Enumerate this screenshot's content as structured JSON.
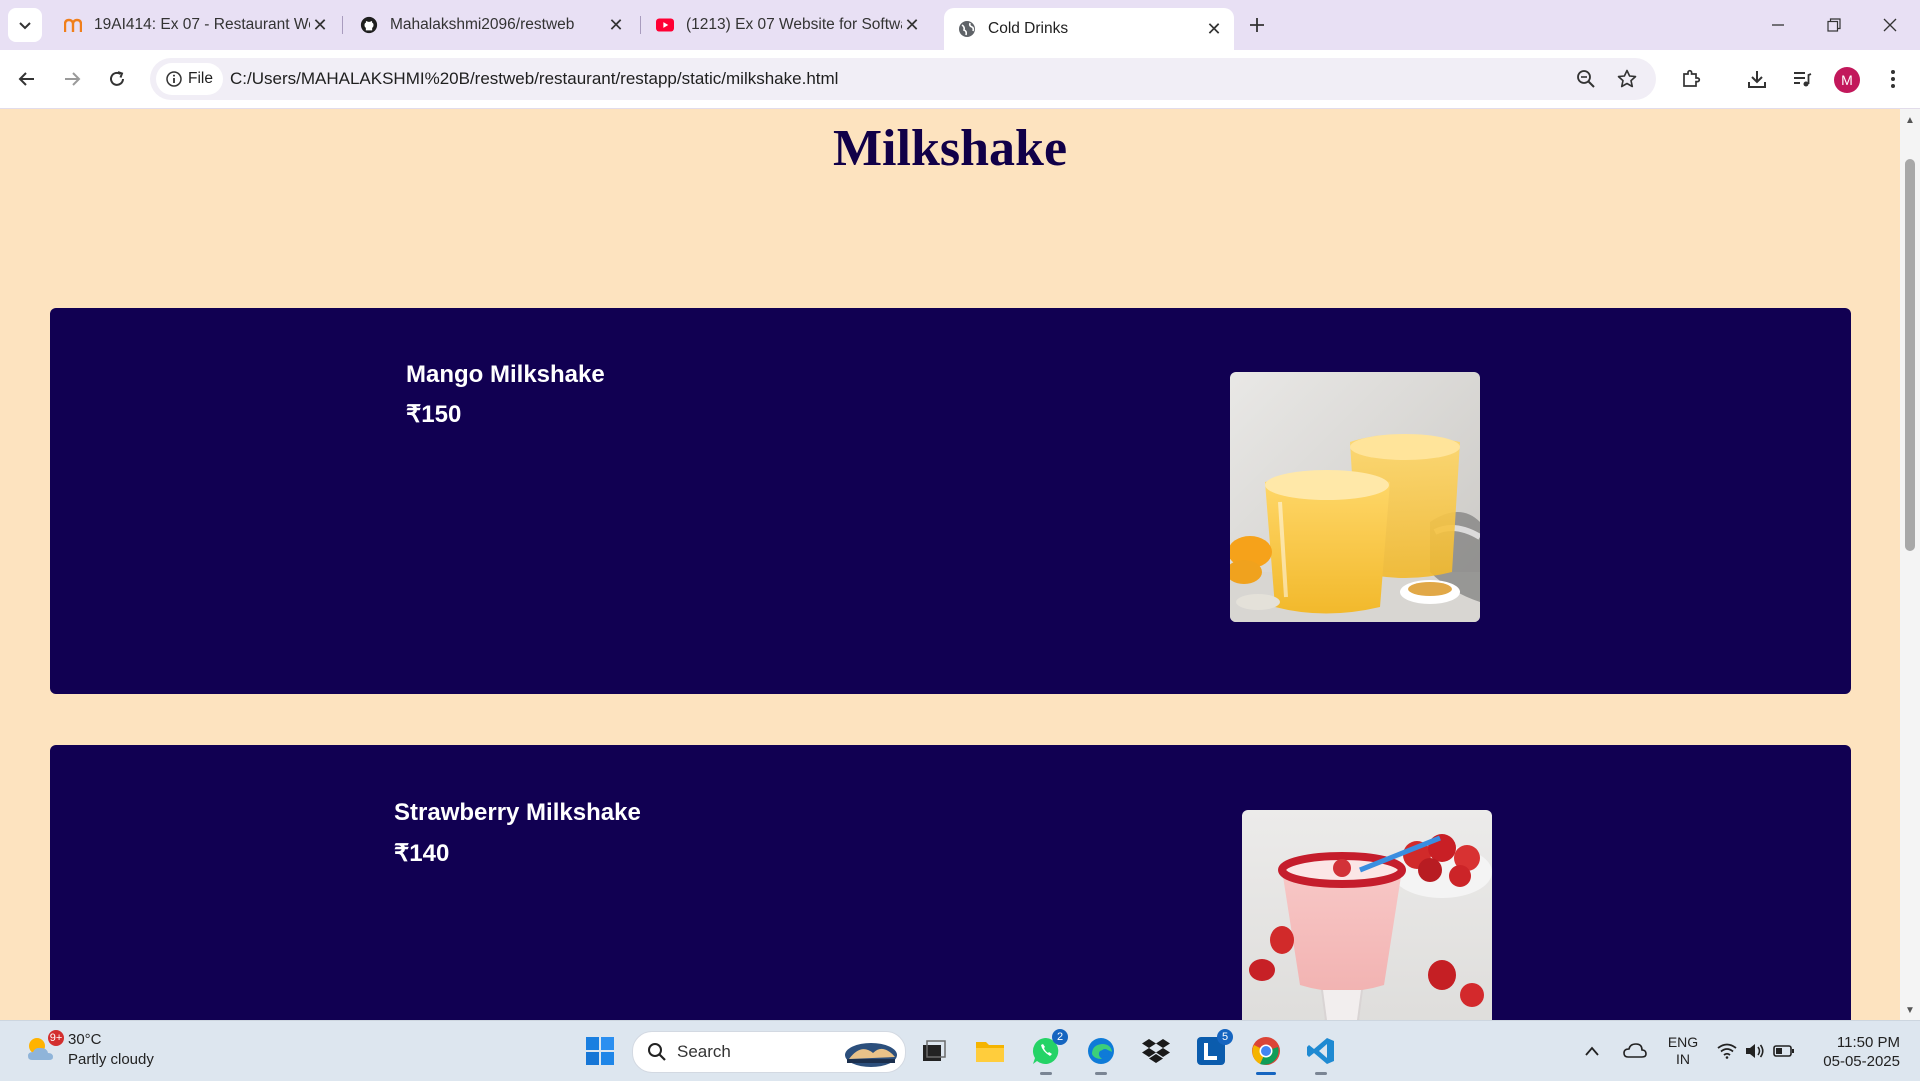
{
  "browser": {
    "tabs": [
      {
        "title": "19AI414: Ex 07 - Restaurant We",
        "favicon": "moodle-icon"
      },
      {
        "title": "Mahalakshmi2096/restweb",
        "favicon": "github-icon"
      },
      {
        "title": "(1213) Ex 07 Website for Softwa",
        "favicon": "youtube-icon"
      },
      {
        "title": "Cold Drinks",
        "favicon": "globe-icon"
      }
    ],
    "chip_label": "File",
    "url": "C:/Users/MAHALAKSHMI%20B/restweb/restaurant/restapp/static/milkshake.html",
    "avatar_letter": "M"
  },
  "page": {
    "title": "Milkshake",
    "items": [
      {
        "name": "Mango Milkshake",
        "price": "₹150"
      },
      {
        "name": "Strawberry Milkshake",
        "price": "₹140"
      }
    ]
  },
  "taskbar": {
    "weather": {
      "temp": "30°C",
      "condition": "Partly cloudy",
      "badge": "9+"
    },
    "search_label": "Search",
    "whatsapp_badge": "2",
    "l_app_badge": "5",
    "lang_top": "ENG",
    "lang_bottom": "IN",
    "time": "11:50 PM",
    "date": "05-05-2025"
  },
  "colors": {
    "page_bg": "#fde3bf",
    "card_bg": "#110052",
    "title_color": "#110048"
  }
}
